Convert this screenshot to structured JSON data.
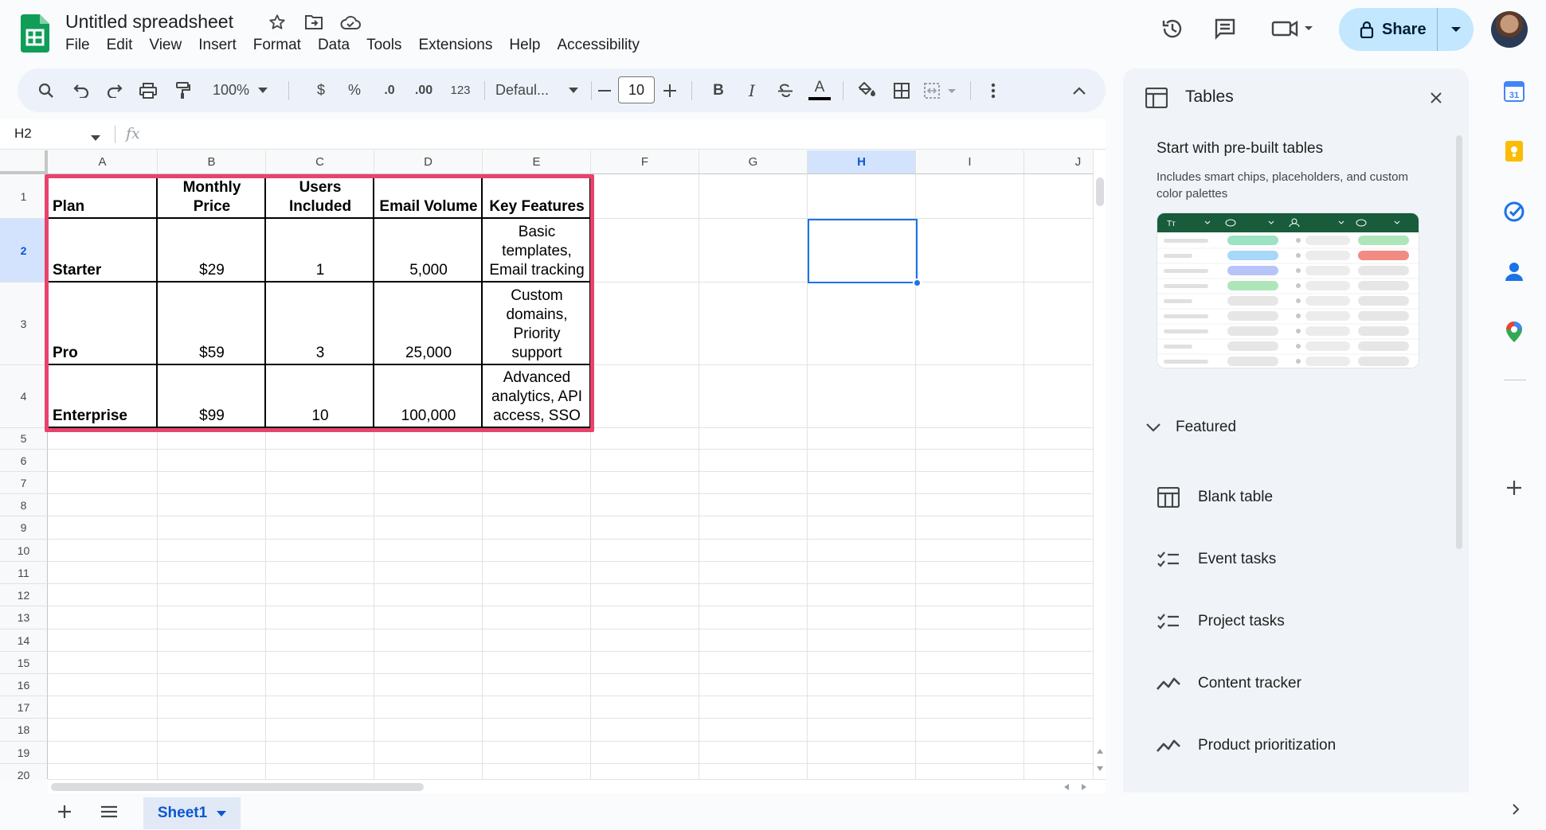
{
  "app": {
    "title": "Untitled spreadsheet",
    "menu": [
      "File",
      "Edit",
      "View",
      "Insert",
      "Format",
      "Data",
      "Tools",
      "Extensions",
      "Help",
      "Accessibility"
    ],
    "share_label": "Share"
  },
  "toolbar": {
    "zoom": "100%",
    "currency": "$",
    "percent": "%",
    "decrease_decimal": ".0",
    "increase_decimal": ".00",
    "number_format": "123",
    "font": "Defaul...",
    "font_size": "10",
    "bold": "B",
    "italic": "I",
    "text_color": "A"
  },
  "formula_bar": {
    "name_box": "H2",
    "fx_label": "fx",
    "value": ""
  },
  "grid": {
    "columns": [
      "A",
      "B",
      "C",
      "D",
      "E",
      "F",
      "G",
      "H",
      "I",
      "J"
    ],
    "selected_column": "H",
    "rows": [
      "1",
      "2",
      "3",
      "4",
      "5",
      "6",
      "7",
      "8",
      "9",
      "10",
      "11",
      "12",
      "13",
      "14",
      "15",
      "16",
      "17",
      "18",
      "19",
      "20"
    ],
    "selected_row": "2",
    "header_cells": [
      "Plan",
      "Monthly Price",
      "Users Included",
      "Email Volume",
      "Key Features"
    ],
    "data_rows": [
      [
        "Starter",
        "$29",
        "1",
        "5,000",
        "Basic templates, Email tracking"
      ],
      [
        "Pro",
        "$59",
        "3",
        "25,000",
        "Custom domains, Priority support"
      ],
      [
        "Enterprise",
        "$99",
        "10",
        "100,000",
        "Advanced analytics, API access, SSO"
      ]
    ]
  },
  "sheet_tabs": {
    "active": "Sheet1"
  },
  "side_panel": {
    "title": "Tables",
    "prebuilt_title": "Start with pre-built tables",
    "prebuilt_desc": "Includes smart chips, placeholders, and custom color palettes",
    "featured_label": "Featured",
    "items": [
      "Blank table",
      "Event tasks",
      "Project tasks",
      "Content tracker",
      "Product prioritization"
    ]
  },
  "colors": {
    "accent": "#0b57d0",
    "highlight_border": "#e8436a",
    "share_bg": "#c2e7ff",
    "panel_bg": "#f0f4f9"
  }
}
